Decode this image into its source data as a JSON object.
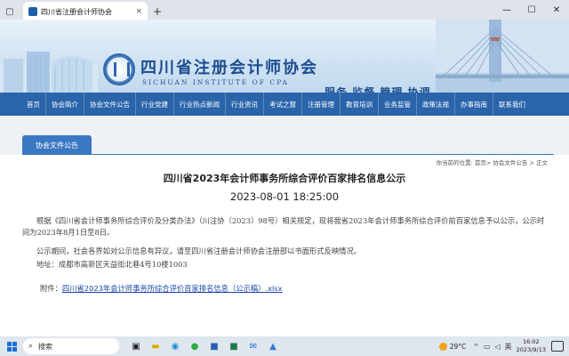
{
  "browser": {
    "tab_title": "四川省注册会计师协会",
    "tab_close": "×",
    "new_tab": "+",
    "back": "←",
    "refresh": "↻",
    "win_min": "—",
    "win_max": "☐",
    "win_close": "✕"
  },
  "header": {
    "org_name_cn": "四川省注册会计师协会",
    "org_name_en": "SICHUAN INSTITUTE OF CPA",
    "slogan": "服务 监督 管理 协调"
  },
  "nav": {
    "items": [
      "首页",
      "协会简介",
      "协会文件公告",
      "行业党建",
      "行业热点新闻",
      "行业资讯",
      "考试之窗",
      "注册管理",
      "教育培训",
      "业务监管",
      "政策法规",
      "办事指南",
      "联系我们"
    ]
  },
  "section": {
    "tab_label": "协会文件公告",
    "breadcrumb": "你当前的位置: 首页> 协会文件公告 > 正文"
  },
  "article": {
    "title": "四川省2023年会计师事务所综合评价百家排名信息公示",
    "datetime": "2023-08-01 18:25:00",
    "para1": "根据《四川省会计师事务所综合评价及分类办法》（川注协〔2023〕98号）相关规定，现将我省2023年会计师事务所综合评价前百家信息予以公示，公示时间为2023年8月1日至8日。",
    "para2": "公示期间，社会各界如对公示信息有异议，请至四川省注册会计师协会注册部以书面形式反映情况。",
    "para3": "地址：成都市高新区天益街北巷4号10楼1003",
    "attach_label": "附件：",
    "attach_link": "四川省2023年会计师事务所综合评价百家排名信息（公示稿）.xlsx"
  },
  "taskbar": {
    "search_placeholder": "搜索",
    "temperature": "29°C",
    "time": "16:02",
    "date": "2023/9/13"
  }
}
